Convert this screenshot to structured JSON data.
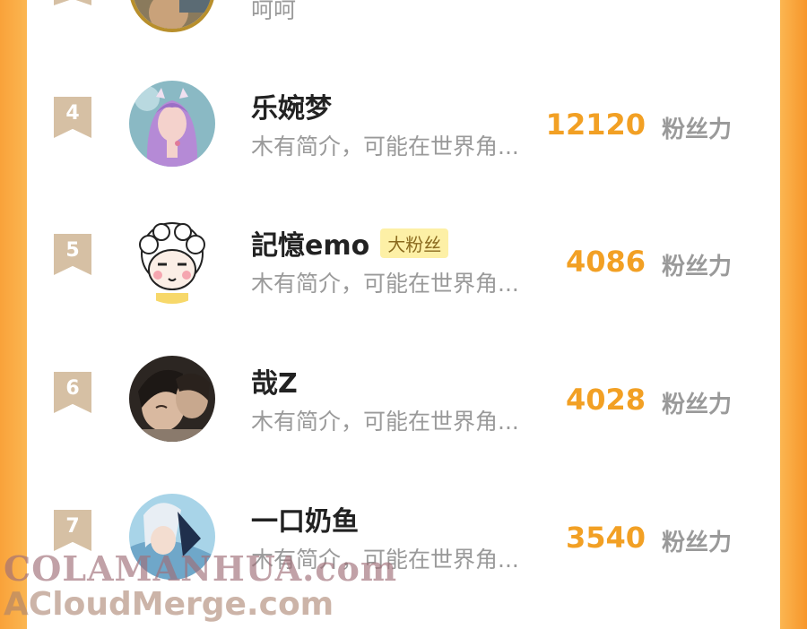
{
  "colors": {
    "accent": "#f2a024",
    "rank_flag": "#d6c0a4",
    "side_bar": "#f9a23a",
    "badge_bg": "#fdf0a6"
  },
  "top_partial": {
    "intro": "呵呵"
  },
  "ranking": [
    {
      "rank": "4",
      "name": "乐婉梦",
      "badge": "",
      "intro": "木有简介，可能在世界角...",
      "score": "12120",
      "unit": "粉丝力"
    },
    {
      "rank": "5",
      "name": "記憶emo",
      "badge": "大粉丝",
      "intro": "木有简介，可能在世界角...",
      "score": "4086",
      "unit": "粉丝力"
    },
    {
      "rank": "6",
      "name": "哉Z",
      "badge": "",
      "intro": "木有简介，可能在世界角...",
      "score": "4028",
      "unit": "粉丝力"
    },
    {
      "rank": "7",
      "name": "一口奶鱼",
      "badge": "",
      "intro": "木有简介，可能在世界角...",
      "score": "3540",
      "unit": "粉丝力"
    }
  ],
  "watermark": {
    "line1": "COLAMANHUA.com",
    "line2": "ACloudMerge.com"
  }
}
